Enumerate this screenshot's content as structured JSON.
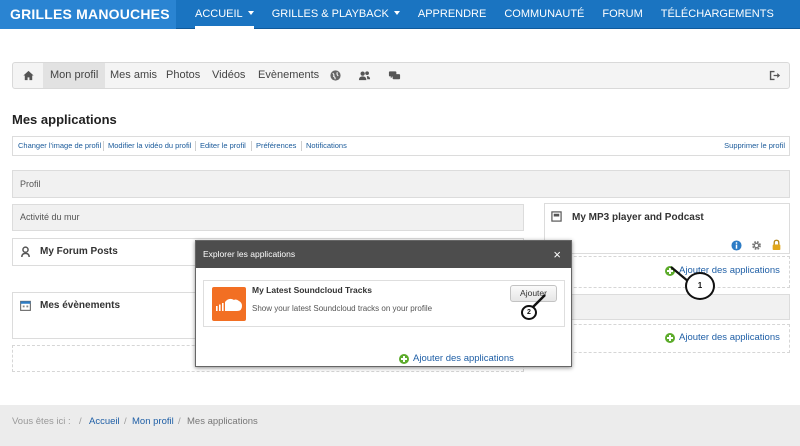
{
  "site": {
    "brand": "GRILLES MANOUCHES"
  },
  "nav": {
    "items": [
      {
        "label": "ACCUEIL"
      },
      {
        "label": "GRILLES & PLAYBACK"
      },
      {
        "label": "APPRENDRE"
      },
      {
        "label": "COMMUNAUTÉ"
      },
      {
        "label": "FORUM"
      },
      {
        "label": "TÉLÉCHARGEMENTS"
      }
    ]
  },
  "profile_toolbar": {
    "items": [
      "Mon profil",
      "Mes amis",
      "Photos",
      "Vidéos",
      "Evènements"
    ],
    "icons": [
      "home-icon",
      "globe-icon",
      "users-icon",
      "chat-icon",
      "logout-icon"
    ]
  },
  "page": {
    "title": "Mes applications"
  },
  "sub_links": {
    "items": [
      "Changer l'image de profil",
      "Modifier la vidéo du profil",
      "Editer le profil",
      "Préférences",
      "Notifications"
    ],
    "right": "Supprimer le profil"
  },
  "sections": {
    "profil": "Profil",
    "activite": "Activité du mur",
    "forum_posts": "My Forum Posts",
    "evenements": "Mes évènements",
    "mp3": "My MP3 player and Podcast"
  },
  "add_apps_label": "Ajouter des applications",
  "modal": {
    "title": "Explorer les applications",
    "close": "×",
    "app": {
      "name": "My Latest Soundcloud Tracks",
      "description": "Show your latest Soundcloud tracks on your profile",
      "button": "Ajouter"
    }
  },
  "callouts": [
    "1",
    "2"
  ],
  "breadcrumb": {
    "prefix": "Vous êtes ici :",
    "items": [
      "Accueil",
      "Mon profil",
      "Mes applications"
    ]
  }
}
